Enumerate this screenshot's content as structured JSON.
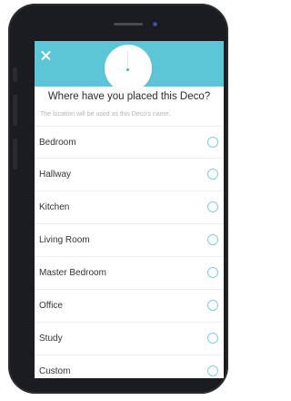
{
  "screen": {
    "title": "Where have you placed this Deco?",
    "subtitle": "The location will be used as this Deco's name."
  },
  "icons": {
    "close": "close-icon",
    "device": "deco-device-icon",
    "radio": "radio-unselected-icon"
  },
  "colors": {
    "accent": "#5cc5d6",
    "radio_border": "#7fcfdc",
    "title_text": "#2b2b2b",
    "subtitle_text": "#b5b5b5"
  },
  "locations": [
    {
      "label": "Bedroom",
      "selected": false
    },
    {
      "label": "Hallway",
      "selected": false
    },
    {
      "label": "Kitchen",
      "selected": false
    },
    {
      "label": "Living Room",
      "selected": false
    },
    {
      "label": "Master Bedroom",
      "selected": false
    },
    {
      "label": "Office",
      "selected": false
    },
    {
      "label": "Study",
      "selected": false
    },
    {
      "label": "Custom",
      "selected": false
    }
  ]
}
